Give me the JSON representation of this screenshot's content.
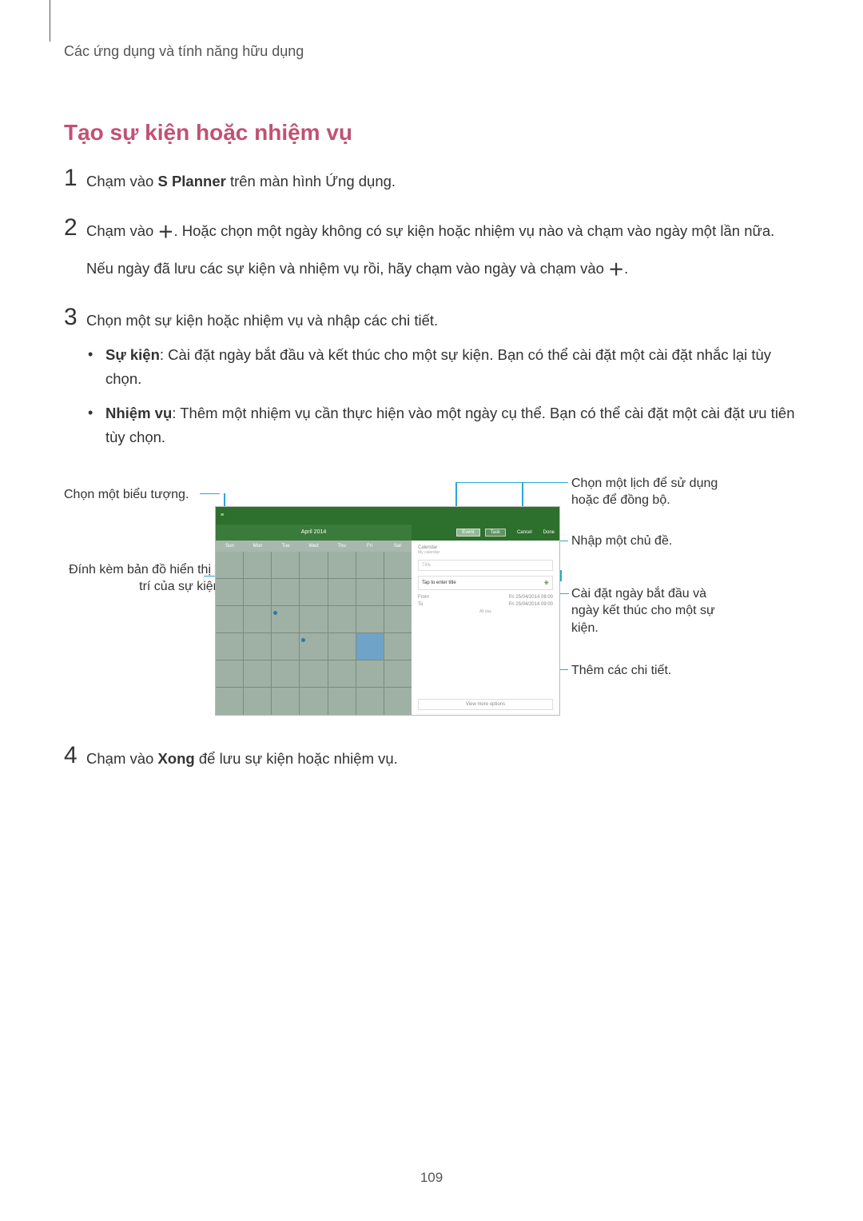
{
  "breadcrumb": "Các ứng dụng và tính năng hữu dụng",
  "title": "Tạo sự kiện hoặc nhiệm vụ",
  "page_number": "109",
  "steps": {
    "s1": {
      "pre": "Chạm vào ",
      "bold": "S Planner",
      "post": " trên màn hình Ứng dụng."
    },
    "s2": {
      "p1_pre": "Chạm vào ",
      "p1_post": ". Hoặc chọn một ngày không có sự kiện hoặc nhiệm vụ nào và chạm vào ngày một lần nữa.",
      "p2_pre": "Nếu ngày đã lưu các sự kiện và nhiệm vụ rồi, hãy chạm vào ngày và chạm vào ",
      "p2_post": "."
    },
    "s3": {
      "intro": "Chọn một sự kiện hoặc nhiệm vụ và nhập các chi tiết.",
      "b1_label": "Sự kiện",
      "b1_text": ": Cài đặt ngày bắt đầu và kết thúc cho một sự kiện. Bạn có thể cài đặt một cài đặt nhắc lại tùy chọn.",
      "b2_label": "Nhiệm vụ",
      "b2_text": ": Thêm một nhiệm vụ cần thực hiện vào một ngày cụ thể. Bạn có thể cài đặt một cài đặt ưu tiên tùy chọn."
    },
    "s4": {
      "pre": "Chạm vào ",
      "bold": "Xong",
      "post": " để lưu sự kiện hoặc nhiệm vụ."
    }
  },
  "callouts": {
    "left1": "Chọn một biểu tượng.",
    "left2": "Đính kèm bản đồ hiển thị vị trí của sự kiện.",
    "right1": "Chọn một lịch để sử dụng hoặc để đồng bộ.",
    "right2": "Nhập một chủ đề.",
    "right3": "Cài đặt ngày bắt đầu và ngày kết thúc cho một sự kiện.",
    "right4": "Thêm các chi tiết."
  },
  "device": {
    "month": "April 2014",
    "days": [
      "Sun",
      "Mon",
      "Tue",
      "Wed",
      "Thu",
      "Fri",
      "Sat"
    ],
    "tabs": {
      "event": "Event",
      "task": "Task"
    },
    "actions": {
      "cancel": "Cancel",
      "done": "Done"
    },
    "calendar_label": "Calendar",
    "calendar_sub": "My calendar",
    "title_placeholder": "Title",
    "location_placeholder": "Tap to enter title",
    "from": "From",
    "to": "To",
    "from_val": "Fri 25/04/2014  08:00",
    "to_val": "Fri 25/04/2014  09:00",
    "allday": "All day",
    "more": "View more options"
  }
}
